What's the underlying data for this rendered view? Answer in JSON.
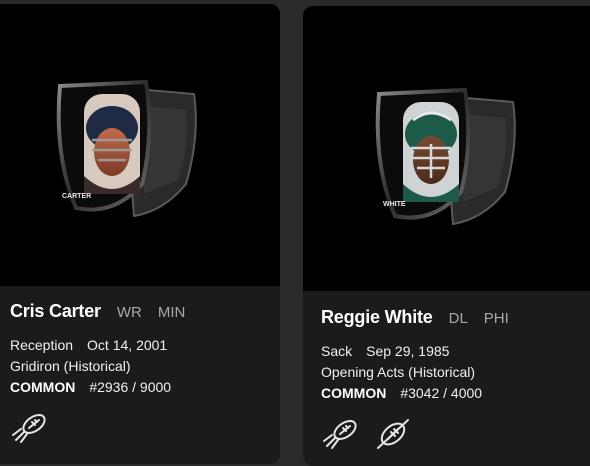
{
  "cards": [
    {
      "player_name": "Cris Carter",
      "position": "WR",
      "team": "MIN",
      "play_type": "Reception",
      "date": "Oct 14, 2001",
      "set_name": "Gridiron (Historical)",
      "tier": "COMMON",
      "serial": "#2936 / 9000",
      "art_nameplate": "CARTER",
      "helmet_color": "#1f2a44",
      "badges": [
        "rocket-football-icon"
      ]
    },
    {
      "player_name": "Reggie White",
      "position": "DL",
      "team": "PHI",
      "play_type": "Sack",
      "date": "Sep 29, 1985",
      "set_name": "Opening Acts (Historical)",
      "tier": "COMMON",
      "serial": "#3042 / 4000",
      "art_nameplate": "WHITE",
      "helmet_color": "#1e5a4a",
      "badges": [
        "rocket-football-icon",
        "crossed-football-icon"
      ]
    }
  ]
}
